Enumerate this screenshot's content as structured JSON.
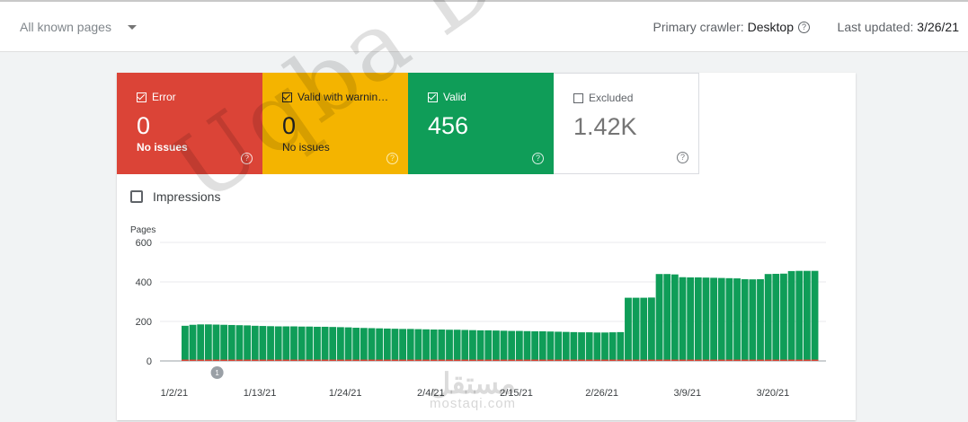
{
  "toolbar": {
    "filter_label": "All known pages",
    "crawler_label": "Primary crawler:",
    "crawler_value": "Desktop",
    "updated_label": "Last updated:",
    "updated_value": "3/26/21"
  },
  "tiles": [
    {
      "key": "error",
      "label": "Error",
      "value": "0",
      "sub": "No issues",
      "checked": true
    },
    {
      "key": "warning",
      "label": "Valid with warnin…",
      "value": "0",
      "sub": "No issues",
      "checked": true
    },
    {
      "key": "valid",
      "label": "Valid",
      "value": "456",
      "sub": "",
      "checked": true
    },
    {
      "key": "excluded",
      "label": "Excluded",
      "value": "1.42K",
      "sub": "",
      "checked": false
    }
  ],
  "impressions_label": "Impressions",
  "watermark": {
    "main": "Uqba Draz",
    "arabic": "مستقل",
    "site": "mostaqi.com"
  },
  "chart_data": {
    "type": "bar",
    "ylabel": "Pages",
    "ylim": [
      0,
      600
    ],
    "y_ticks": [
      0,
      200,
      400,
      600
    ],
    "x_tick_labels": [
      "1/2/21",
      "1/13/21",
      "1/24/21",
      "2/4/21",
      "2/15/21",
      "2/26/21",
      "3/9/21",
      "3/20/21"
    ],
    "start_date": "1/2/21",
    "annotation": {
      "label": "1",
      "date": "1/7/21"
    },
    "series": [
      {
        "name": "Valid",
        "color": "#0f9d58",
        "values": [
          178,
          183,
          185,
          185,
          184,
          183,
          182,
          181,
          180,
          178,
          177,
          176,
          175,
          175,
          175,
          174,
          174,
          173,
          173,
          172,
          171,
          170,
          168,
          167,
          166,
          165,
          164,
          163,
          162,
          162,
          161,
          160,
          159,
          159,
          158,
          158,
          157,
          156,
          155,
          155,
          154,
          153,
          152,
          152,
          151,
          150,
          150,
          149,
          148,
          147,
          146,
          145,
          145,
          144,
          144,
          145,
          146,
          320,
          320,
          320,
          321,
          440,
          440,
          438,
          424,
          423,
          423,
          422,
          421,
          420,
          419,
          418,
          414,
          413,
          414,
          440,
          441,
          442,
          455,
          456,
          456,
          456
        ]
      },
      {
        "name": "Error",
        "color": "#db4437",
        "values": [
          0,
          0,
          0,
          0,
          0,
          0,
          0,
          0,
          0,
          0,
          0,
          0,
          0,
          0,
          0,
          0,
          0,
          0,
          0,
          0,
          0,
          0,
          0,
          0,
          0,
          0,
          0,
          0,
          0,
          0,
          0,
          0,
          0,
          0,
          0,
          0,
          0,
          0,
          0,
          0,
          0,
          0,
          0,
          0,
          0,
          0,
          0,
          0,
          0,
          0,
          0,
          0,
          0,
          0,
          0,
          0,
          0,
          0,
          0,
          0,
          0,
          0,
          0,
          0,
          0,
          0,
          0,
          0,
          0,
          0,
          0,
          0,
          0,
          0,
          0,
          0,
          0,
          0,
          0,
          0,
          0,
          0
        ]
      }
    ]
  }
}
